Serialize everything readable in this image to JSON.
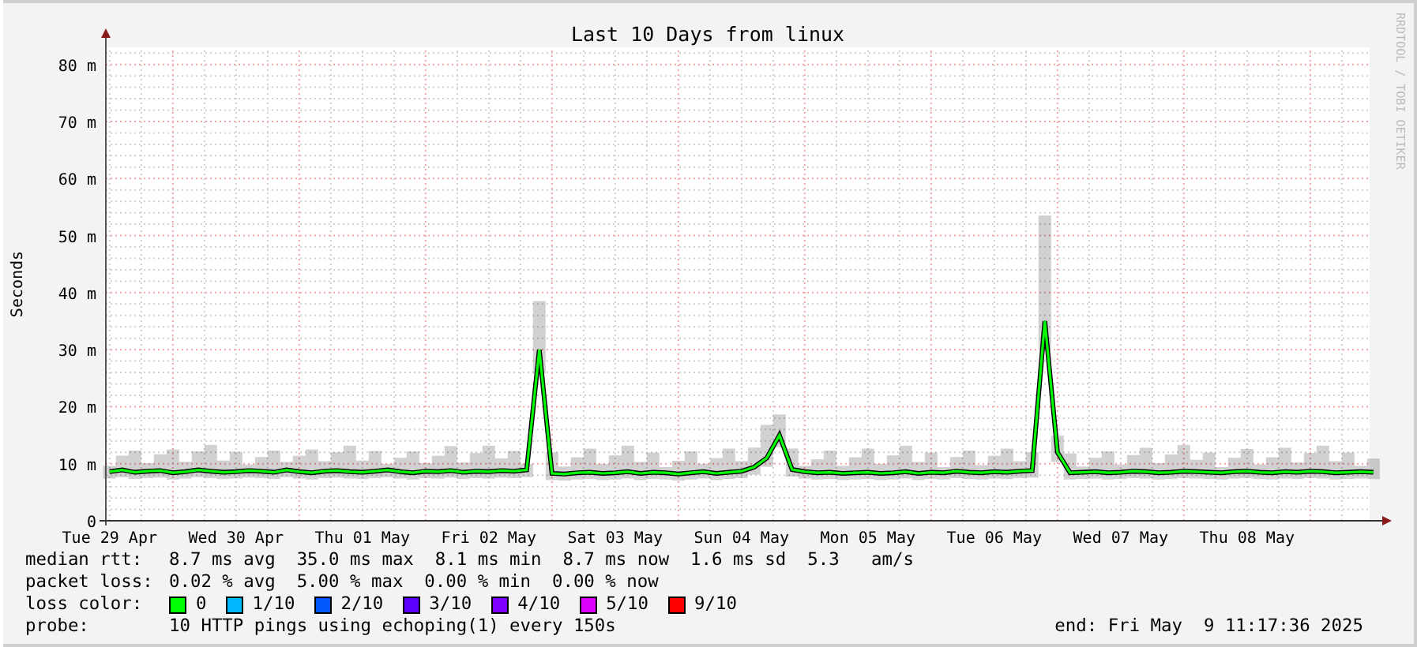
{
  "credit": "RRDTOOL / TOBI OETIKER",
  "chart": {
    "chart_data": {
      "type": "line",
      "grid": true,
      "title": "Last 10 Days from linux",
      "ylabel": "Seconds",
      "ylim": [
        0,
        83
      ],
      "yticks": [
        {
          "value": 0,
          "label": "0"
        },
        {
          "value": 10,
          "label": "10 m"
        },
        {
          "value": 20,
          "label": "20 m"
        },
        {
          "value": 30,
          "label": "30 m"
        },
        {
          "value": 40,
          "label": "40 m"
        },
        {
          "value": 50,
          "label": "50 m"
        },
        {
          "value": 60,
          "label": "60 m"
        },
        {
          "value": 70,
          "label": "70 m"
        },
        {
          "value": 80,
          "label": "80 m"
        }
      ],
      "categories": [
        "Tue 29 Apr",
        null,
        null,
        null,
        null,
        null,
        null,
        null,
        null,
        null,
        "Wed 30 Apr",
        null,
        null,
        null,
        null,
        null,
        null,
        null,
        null,
        null,
        "Thu 01 May",
        null,
        null,
        null,
        null,
        null,
        null,
        null,
        null,
        null,
        "Fri 02 May",
        null,
        null,
        null,
        null,
        null,
        null,
        null,
        null,
        null,
        "Sat 03 May",
        null,
        null,
        null,
        null,
        null,
        null,
        null,
        null,
        null,
        "Sun 04 May",
        null,
        null,
        null,
        null,
        null,
        null,
        null,
        null,
        null,
        "Mon 05 May",
        null,
        null,
        null,
        null,
        null,
        null,
        null,
        null,
        null,
        "Tue 06 May",
        null,
        null,
        null,
        null,
        null,
        null,
        null,
        null,
        null,
        "Wed 07 May",
        null,
        null,
        null,
        null,
        null,
        null,
        null,
        null,
        null,
        "Thu 08 May",
        null,
        null,
        null,
        null,
        null,
        null,
        null,
        null,
        null,
        null
      ],
      "series": [
        {
          "name": "median rtt:",
          "color": "#00ff00",
          "values": [
            8.6,
            8.9,
            8.5,
            8.7,
            8.8,
            8.4,
            8.6,
            8.9,
            8.7,
            8.5,
            8.6,
            8.8,
            8.7,
            8.5,
            8.9,
            8.6,
            8.4,
            8.7,
            8.8,
            8.6,
            8.5,
            8.7,
            8.9,
            8.6,
            8.4,
            8.7,
            8.6,
            8.8,
            8.5,
            8.7,
            8.6,
            8.8,
            8.7,
            8.9,
            30,
            8.3,
            8.2,
            8.4,
            8.5,
            8.3,
            8.4,
            8.6,
            8.3,
            8.5,
            8.4,
            8.2,
            8.4,
            8.6,
            8.3,
            8.5,
            8.7,
            9.4,
            11,
            15,
            9.0,
            8.6,
            8.4,
            8.5,
            8.3,
            8.4,
            8.5,
            8.3,
            8.4,
            8.6,
            8.3,
            8.5,
            8.4,
            8.7,
            8.5,
            8.4,
            8.6,
            8.5,
            8.7,
            8.8,
            35,
            12,
            8.4,
            8.5,
            8.6,
            8.4,
            8.5,
            8.7,
            8.6,
            8.4,
            8.5,
            8.7,
            8.6,
            8.5,
            8.4,
            8.6,
            8.7,
            8.5,
            8.4,
            8.6,
            8.5,
            8.7,
            8.6,
            8.4,
            8.5,
            8.6,
            8.5
          ]
        }
      ]
    }
  },
  "legend": {
    "stats": [
      {
        "text": "8.7 ms avg  35.0 ms max  8.1 ms min  8.7 ms now  1.6 ms sd  5.3   am/s"
      },
      {
        "label": "packet loss:",
        "text": "0.02 % avg  5.00 % max  0.00 % min  0.00 % now"
      }
    ],
    "loss_color": {
      "label": "loss color:",
      "items": [
        {
          "label": "0",
          "color": "#00ff00"
        },
        {
          "label": "1/10",
          "color": "#00b8ff"
        },
        {
          "label": "2/10",
          "color": "#0059ff"
        },
        {
          "label": "3/10",
          "color": "#5e00ff"
        },
        {
          "label": "4/10",
          "color": "#7e00ff"
        },
        {
          "label": "5/10",
          "color": "#dd00ff"
        },
        {
          "label": "9/10",
          "color": "#ff0000"
        }
      ]
    },
    "probe": {
      "label": "probe:",
      "text": "10 HTTP pings using echoping(1) every 150s"
    },
    "end": "end: Fri May  9 11:17:36 2025"
  }
}
